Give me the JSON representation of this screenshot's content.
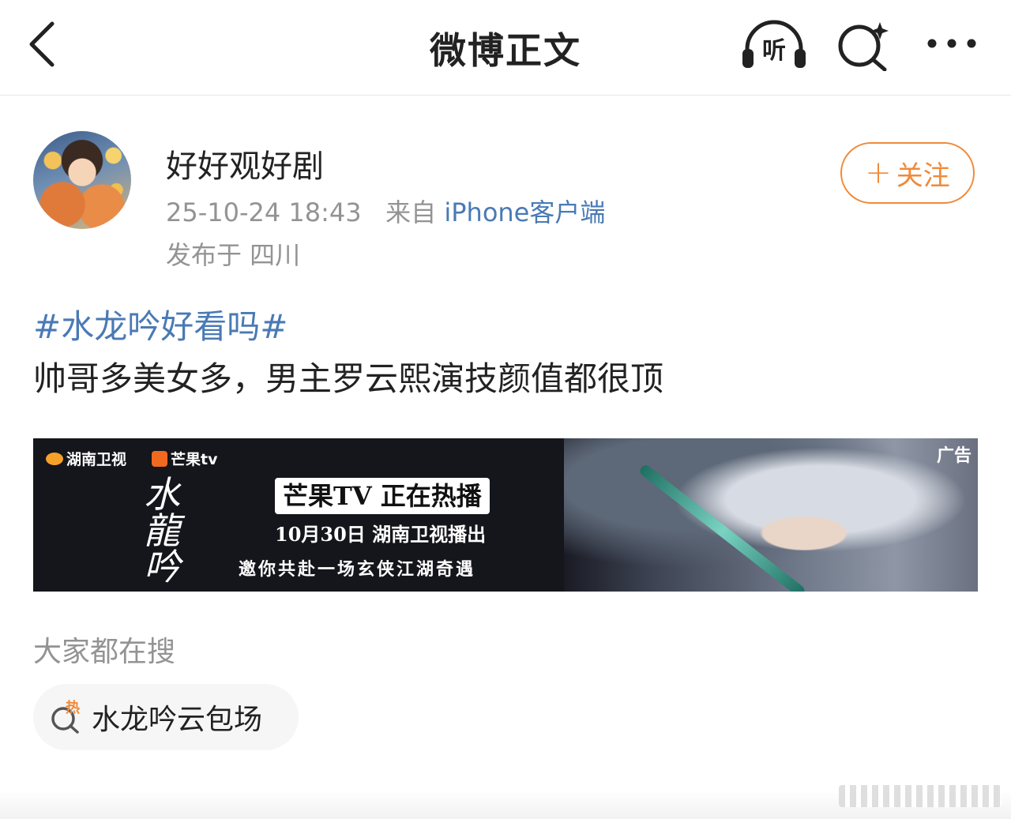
{
  "nav": {
    "title": "微博正文",
    "listen_label": "听"
  },
  "author": {
    "name": "好好观好剧",
    "time": "25-10-24 18:43",
    "from_prefix": "来自",
    "source": "iPhone客户端",
    "location": "发布于 四川",
    "follow_plus": "+",
    "follow_label": "关注"
  },
  "post": {
    "hashtag": "#水龙吟好看吗#",
    "text": "帅哥多美女多，男主罗云熙演技颜值都很顶"
  },
  "ad": {
    "tag": "广告",
    "logo_hunan": "湖南卫视",
    "logo_mango": "芒果tv",
    "drama_title": "水龍吟",
    "headline": "芒果TV 正在热播",
    "date": "10月30日 湖南卫视播出",
    "slogan": "邀你共赴一场玄侠江湖奇遇"
  },
  "search_section": {
    "title": "大家都在搜",
    "hot_badge": "热",
    "items": [
      {
        "label": "水龙吟云包场"
      }
    ]
  },
  "colors": {
    "accent_orange": "#f08a3a",
    "link_blue": "#4a7ab5",
    "meta_gray": "#939393"
  },
  "icons": [
    "back-icon",
    "listen-icon",
    "search-sparkle-icon",
    "more-icon",
    "hot-search-icon"
  ]
}
